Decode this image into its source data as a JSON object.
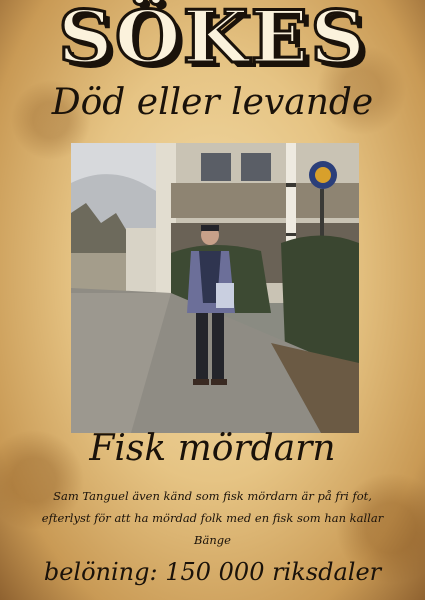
{
  "poster": {
    "title": "SÖKES",
    "subtitle": "Död eller levande",
    "name": "Fisk mördarn",
    "description": "Sam Tanguel även känd som fisk mördarn är på fri fot, efterlyst för att ha mördad folk med en fisk som han kallar Bänge",
    "reward": "belöning: 150 000 riksdaler"
  },
  "colors": {
    "paper": "#e6c484",
    "ink": "#1a120a"
  }
}
